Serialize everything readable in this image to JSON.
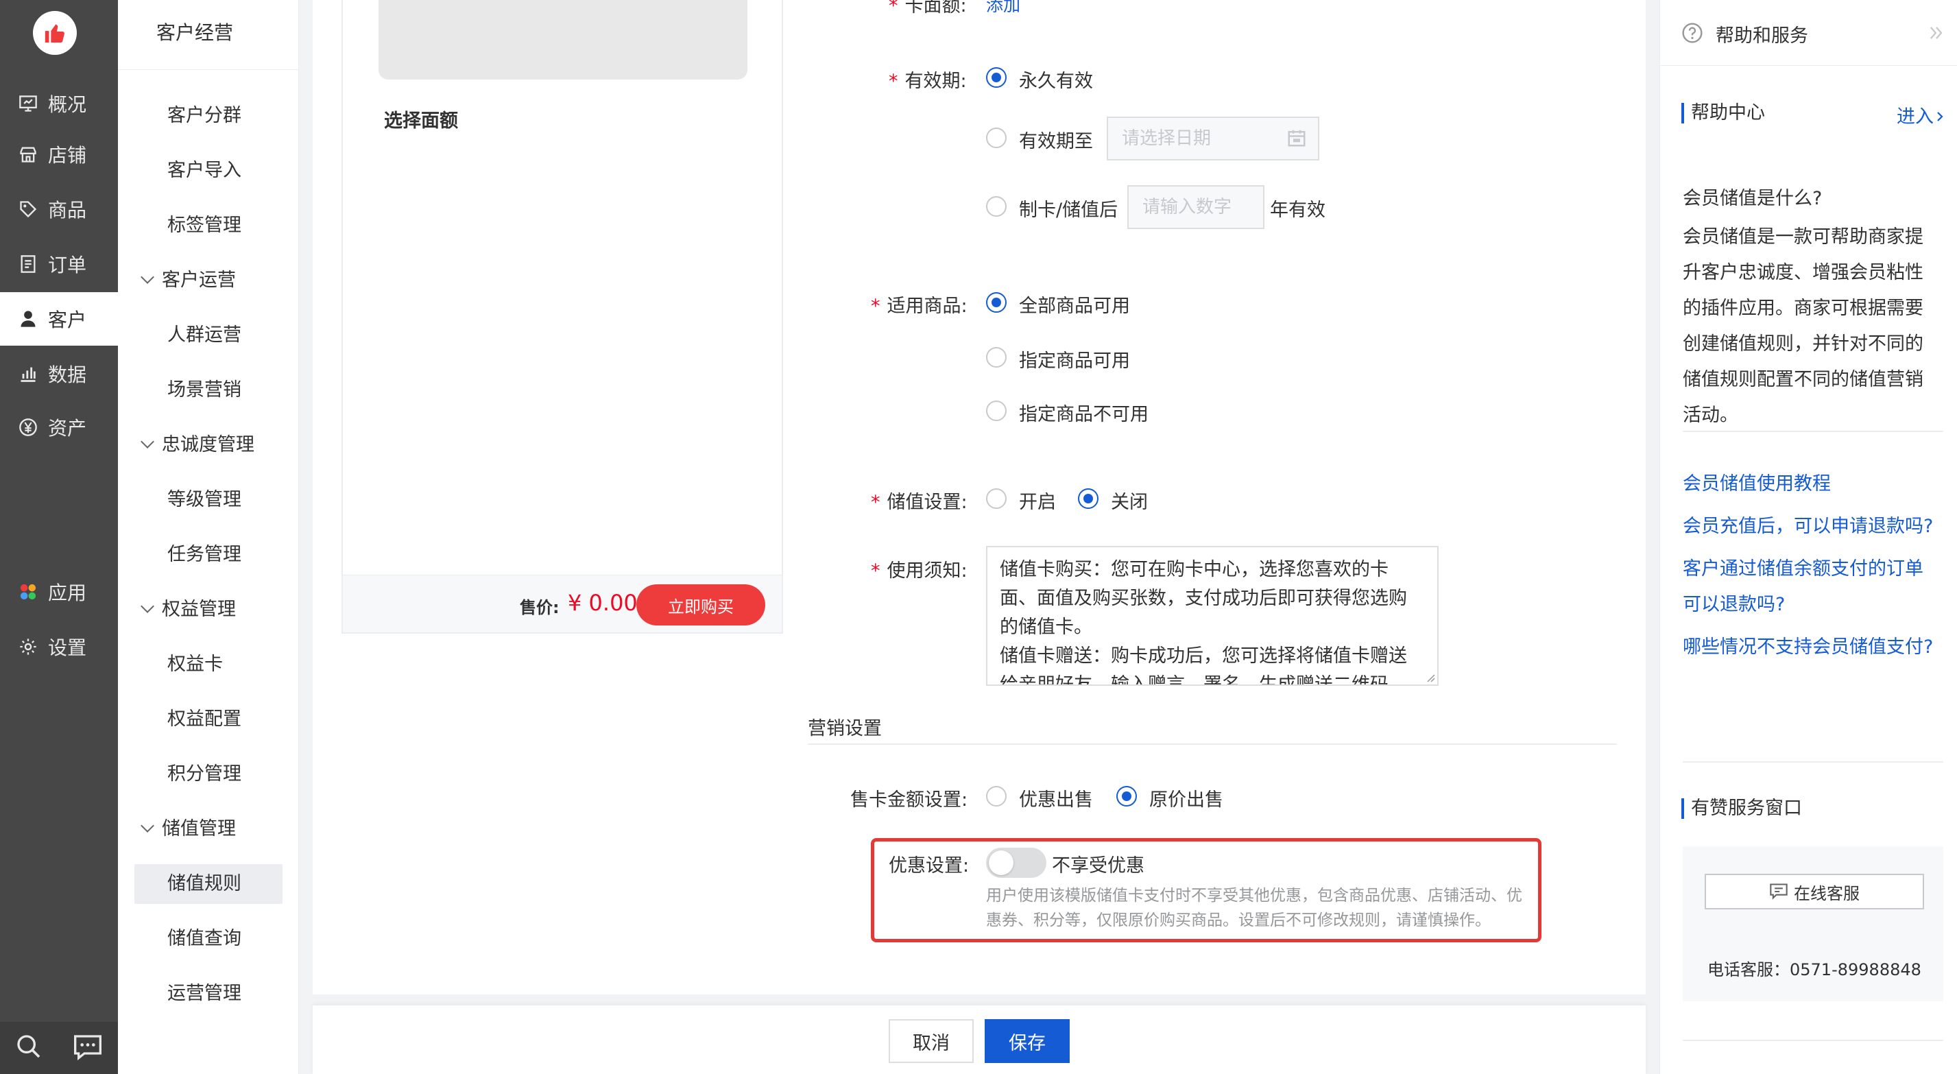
{
  "primary_nav": [
    {
      "label": "概况",
      "icon": "overview-icon"
    },
    {
      "label": "店铺",
      "icon": "store-icon"
    },
    {
      "label": "商品",
      "icon": "tag-icon"
    },
    {
      "label": "订单",
      "icon": "order-icon"
    },
    {
      "label": "客户",
      "icon": "user-icon"
    },
    {
      "label": "数据",
      "icon": "chart-icon"
    },
    {
      "label": "资产",
      "icon": "yuan-icon"
    },
    {
      "label": "应用",
      "icon": "apps-icon"
    },
    {
      "label": "设置",
      "icon": "gear-icon"
    }
  ],
  "secondary": {
    "title": "客户经营",
    "items": [
      "客户分群",
      "客户导入",
      "标签管理"
    ],
    "groups": [
      {
        "label": "客户运营",
        "items": [
          "人群运营",
          "场景营销"
        ]
      },
      {
        "label": "忠诚度管理",
        "items": [
          "等级管理",
          "任务管理"
        ]
      },
      {
        "label": "权益管理",
        "items": [
          "权益卡",
          "权益配置",
          "积分管理"
        ]
      },
      {
        "label": "储值管理",
        "items": [
          "储值规则",
          "储值查询",
          "运营管理"
        ]
      }
    ],
    "active": "储值规则"
  },
  "preview": {
    "select_face": "选择面额",
    "price_label": "售价:",
    "price_value": "¥ 0.00",
    "buy_label": "立即购买"
  },
  "form": {
    "card_amount_label": "卡面额:",
    "card_amount_link": "添加",
    "validity_label": "有效期:",
    "validity_options": [
      "永久有效",
      "有效期至",
      "制卡/储值后"
    ],
    "date_placeholder": "请选择日期",
    "number_placeholder": "请输入数字",
    "years_suffix": "年有效",
    "goods_label": "适用商品:",
    "goods_options": [
      "全部商品可用",
      "指定商品可用",
      "指定商品不可用"
    ],
    "stored_label": "储值设置:",
    "stored_options": [
      "开启",
      "关闭"
    ],
    "notes_label": "使用须知:",
    "notes_text": "储值卡购买：您可在购卡中心，选择您喜欢的卡面、面值及购买张数，支付成功后即可获得您选购的储值卡。\n储值卡赠送：购卡成功后，您可选择将储值卡赠送给亲朋好友，输入赠言、署名，生成赠送二维码",
    "section_title": "营销设置",
    "sale_amount_label": "售卡金额设置:",
    "sale_amount_options": [
      "优惠出售",
      "原价出售"
    ],
    "discount_label": "优惠设置:",
    "discount_toggle_text": "不享受优惠",
    "discount_help": "用户使用该模版储值卡支付时不享受其他优惠，包含商品优惠、店铺活动、优惠券、积分等，仅限原价购买商品。设置后不可修改规则，请谨慎操作。"
  },
  "footer": {
    "cancel": "取消",
    "save": "保存"
  },
  "help": {
    "title": "帮助和服务",
    "center_label": "帮助中心",
    "enter_label": "进入",
    "question": "会员储值是什么?",
    "answer": "会员储值是一款可帮助商家提升客户忠诚度、增强会员粘性的插件应用。商家可根据需要创建储值规则，并针对不同的储值规则配置不同的储值营销活动。",
    "links": [
      "会员储值使用教程",
      "会员充值后，可以申请退款吗?",
      "客户通过储值余额支付的订单可以退款吗?",
      "哪些情况不支持会员储值支付?"
    ],
    "service_label": "有赞服务窗口",
    "online_service": "在线客服",
    "phone": "电话客服：0571-89988848"
  },
  "colors": {
    "accent": "#155bd4",
    "danger": "#ee0a24",
    "sidebar": "#474747"
  }
}
